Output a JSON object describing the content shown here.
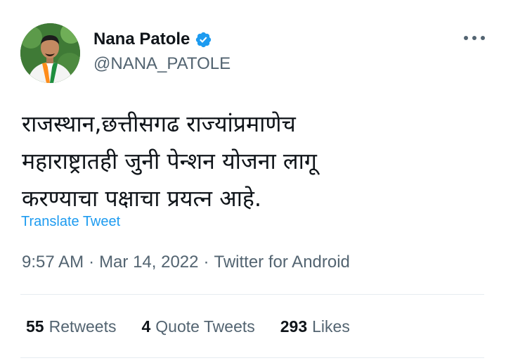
{
  "author": {
    "display_name": "Nana Patole",
    "handle": "@NANA_PATOLE",
    "verified": true,
    "verified_color": "#1d9bf0"
  },
  "tweet": {
    "text_lines": [
      "राजस्थान,छत्तीसगढ राज्यांप्रमाणेच",
      "महाराष्ट्रातही जुनी पेन्शन योजना लागू",
      "करण्याचा पक्षाचा प्रयत्न आहे."
    ],
    "translate_label": "Translate Tweet",
    "time": "9:57 AM",
    "separator": "·",
    "date": "Mar 14, 2022",
    "source": "Twitter for Android"
  },
  "stats": {
    "retweets": {
      "count": "55",
      "label": "Retweets"
    },
    "quote_tweets": {
      "count": "4",
      "label": "Quote Tweets"
    },
    "likes": {
      "count": "293",
      "label": "Likes"
    }
  },
  "icons": {
    "avatar": "profile-photo",
    "verified": "verified-badge-icon",
    "more": "more-options-icon"
  },
  "colors": {
    "text": "#0f1419",
    "secondary": "#536471",
    "link": "#1d9bf0",
    "divider": "#e6ecf0"
  }
}
